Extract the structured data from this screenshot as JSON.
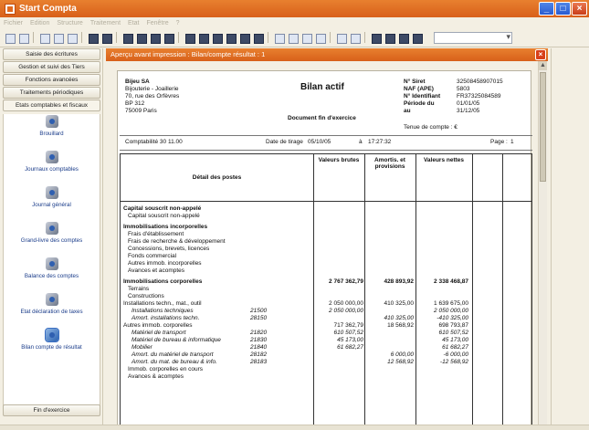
{
  "window": {
    "title": "Start Compta"
  },
  "menubar": [
    "Fichier",
    "Edition",
    "Structure",
    "Traitement",
    "Etat",
    "Fenêtre",
    "?"
  ],
  "sidebar": {
    "nav_buttons": [
      "Saisie des écritures",
      "Gestion et suivi des Tiers",
      "Fonctions avancées",
      "Traitements périodiques",
      "Etats comptables et fiscaux"
    ],
    "items": [
      {
        "label": "Brouillard",
        "icon": "report-icon"
      },
      {
        "label": "Journaux comptables",
        "icon": "journals-icon"
      },
      {
        "label": "Journal général",
        "icon": "journal-icon"
      },
      {
        "label": "Grand-livre des comptes",
        "icon": "ledger-icon"
      },
      {
        "label": "Balance des comptes",
        "icon": "balance-icon"
      },
      {
        "label": "Etat déclaration de taxes",
        "icon": "tax-icon"
      },
      {
        "label": "Bilan compte de résultat",
        "icon": "balance-sheet-icon"
      }
    ],
    "bottom_button": "Fin d'exercice"
  },
  "preview": {
    "title": "Aperçu avant impression : Bilan/compte résultat : 1",
    "close": "×"
  },
  "document": {
    "company": {
      "name": "Bijeu SA",
      "activity": "Bijouterie - Joaillerie",
      "address": "70, rue des Orfèvres",
      "bp": "BP 312",
      "city": "75009   Paris"
    },
    "title": "Bilan actif",
    "subtitle": "Document fin d'exercice",
    "ids": [
      {
        "key": "N° Siret",
        "value": "32508458907015"
      },
      {
        "key": "NAF (APE)",
        "value": "5803"
      },
      {
        "key": "N° Identifiant",
        "value": "FR37325084589"
      },
      {
        "key": "Période du",
        "value": "01/01/05"
      },
      {
        "key": "au",
        "value": "31/12/05"
      }
    ],
    "tenue": "Tenue de compte : €",
    "meta": {
      "app": "Comptabilité 30 11.00",
      "date_label": "Date de tirage",
      "date": "05/10/05",
      "time_label": "à",
      "time": "17:27:32",
      "page_label": "Page :",
      "page": "1"
    },
    "headers": {
      "detail": "Détail des postes",
      "brut": "Valeurs brutes",
      "amort": "Amortis. et provisions",
      "nettes": "Valeurs nettes"
    },
    "rows": [
      {
        "cls": "bold",
        "label": "Capital souscrit non-appelé",
        "code": "",
        "v1": "",
        "v2": "",
        "v3": ""
      },
      {
        "cls": "ind1",
        "label": "Capital souscrit non-appelé",
        "code": "",
        "v1": "",
        "v2": "",
        "v3": ""
      },
      {
        "cls": "gap",
        "label": "",
        "code": "",
        "v1": "",
        "v2": "",
        "v3": ""
      },
      {
        "cls": "bold",
        "label": "Immobilisations incorporelles",
        "code": "",
        "v1": "",
        "v2": "",
        "v3": ""
      },
      {
        "cls": "ind1",
        "label": "Frais d'établissement",
        "code": "",
        "v1": "",
        "v2": "",
        "v3": ""
      },
      {
        "cls": "ind1",
        "label": "Frais de recherche & développement",
        "code": "",
        "v1": "",
        "v2": "",
        "v3": ""
      },
      {
        "cls": "ind1",
        "label": "Concessions, brevets, licences",
        "code": "",
        "v1": "",
        "v2": "",
        "v3": ""
      },
      {
        "cls": "ind1",
        "label": "Fonds commercial",
        "code": "",
        "v1": "",
        "v2": "",
        "v3": ""
      },
      {
        "cls": "ind1",
        "label": "Autres immob. incorporelles",
        "code": "",
        "v1": "",
        "v2": "",
        "v3": ""
      },
      {
        "cls": "ind1",
        "label": "Avances et acomptes",
        "code": "",
        "v1": "",
        "v2": "",
        "v3": ""
      },
      {
        "cls": "gap",
        "label": "",
        "code": "",
        "v1": "",
        "v2": "",
        "v3": ""
      },
      {
        "cls": "bold",
        "label": "Immobilisations corporelles",
        "code": "",
        "v1": "2 767 362,79",
        "v2": "428 893,92",
        "v3": "2 338 468,87"
      },
      {
        "cls": "ind1",
        "label": "Terrains",
        "code": "",
        "v1": "",
        "v2": "",
        "v3": ""
      },
      {
        "cls": "ind1",
        "label": "Constructions",
        "code": "",
        "v1": "",
        "v2": "",
        "v3": ""
      },
      {
        "cls": "",
        "label": "Installations techn., mat., outil",
        "code": "",
        "v1": "2 050 000,00",
        "v2": "410 325,00",
        "v3": "1 639 675,00"
      },
      {
        "cls": "ital",
        "label": "Installations techniques",
        "code": "21500",
        "v1": "2 050 000,00",
        "v2": "",
        "v3": "2 050 000,00"
      },
      {
        "cls": "ital",
        "label": "Amort. installations techn.",
        "code": "28150",
        "v1": "",
        "v2": "410 325,00",
        "v3": "-410 325,00"
      },
      {
        "cls": "",
        "label": "Autres immob. corporelles",
        "code": "",
        "v1": "717 362,79",
        "v2": "18 568,92",
        "v3": "698 793,87"
      },
      {
        "cls": "ital",
        "label": "Matériel de transport",
        "code": "21820",
        "v1": "610 507,52",
        "v2": "",
        "v3": "610 507,52"
      },
      {
        "cls": "ital",
        "label": "Matériel de bureau & informatique",
        "code": "21830",
        "v1": "45 173,00",
        "v2": "",
        "v3": "45 173,00"
      },
      {
        "cls": "ital",
        "label": "Mobilier",
        "code": "21840",
        "v1": "61 682,27",
        "v2": "",
        "v3": "61 682,27"
      },
      {
        "cls": "ital",
        "label": "Amort. du matériel de transport",
        "code": "28182",
        "v1": "",
        "v2": "6 000,00",
        "v3": "-6 000,00"
      },
      {
        "cls": "ital",
        "label": "Amort. du mat. de bureau & info.",
        "code": "28183",
        "v1": "",
        "v2": "12 568,92",
        "v3": "-12 568,92"
      },
      {
        "cls": "ind1",
        "label": "Immob. corporelles en cours",
        "code": "",
        "v1": "",
        "v2": "",
        "v3": ""
      },
      {
        "cls": "ind1",
        "label": "Avances & acomptes",
        "code": "",
        "v1": "",
        "v2": "",
        "v3": ""
      }
    ]
  }
}
